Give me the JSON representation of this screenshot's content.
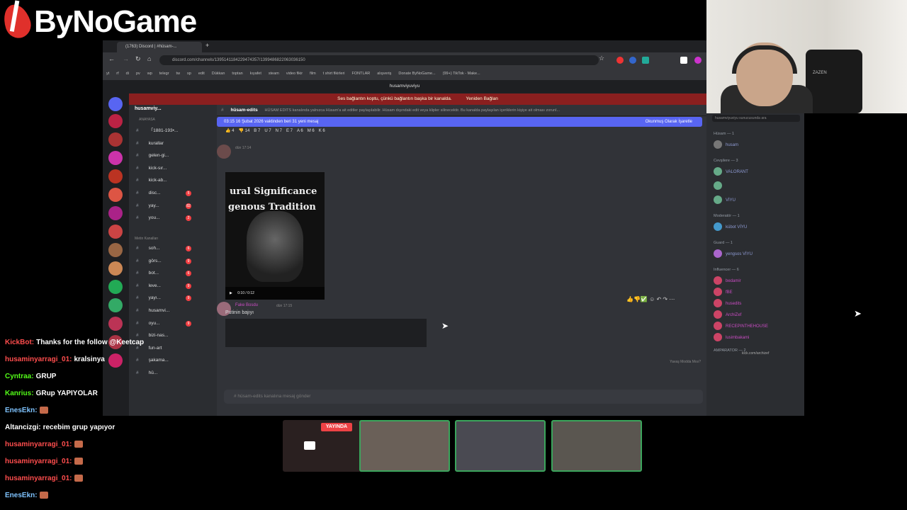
{
  "brand": {
    "logo_text": "ByNoGame"
  },
  "browser": {
    "tab_title": "(1763) Discord | #hüsam-...",
    "url": "discord.com/channels/1395141184229474357/1399486822063036150",
    "bookmarks": [
      "yt",
      "rf",
      "di",
      "pv",
      "wp",
      "telegr",
      "tw",
      "sp",
      "edit",
      "Dükkan",
      "toptan",
      "kıyafet",
      "steam",
      "video fikir",
      "film",
      "t shirt fikirleri",
      "FONTLAR",
      "alışveriş",
      "Donate ByNoGame...",
      "(99+) TikTok - Make..."
    ]
  },
  "discord": {
    "top_user": "husamviyuviyu",
    "banner": "Ses bağlantın koptu, çünkü bağlantın başka bir kanalda.",
    "banner_action": "Yeniden Bağlan",
    "server_name": "husamviy...",
    "category1": "ANAYASA",
    "category2": "Metin Kanalları",
    "channels_top": [
      {
        "name": "「1881-193•...",
        "badge": ""
      },
      {
        "name": "kurallar",
        "badge": ""
      },
      {
        "name": "gelen-gi...",
        "badge": ""
      },
      {
        "name": "kick-sır...",
        "badge": ""
      },
      {
        "name": "kick-ab...",
        "badge": ""
      },
      {
        "name": "disc...",
        "badge": "5"
      },
      {
        "name": "yay...",
        "badge": "82"
      },
      {
        "name": "you...",
        "badge": "2"
      }
    ],
    "channels_text": [
      {
        "name": "soh...",
        "badge": "6"
      },
      {
        "name": "görs...",
        "badge": "9"
      },
      {
        "name": "bot...",
        "badge": "6"
      },
      {
        "name": "leve...",
        "badge": "9"
      },
      {
        "name": "yayı...",
        "badge": "9"
      },
      {
        "name": "husamvi...",
        "badge": ""
      },
      {
        "name": "oyu...",
        "badge": "9"
      },
      {
        "name": "bizi-nas...",
        "badge": ""
      },
      {
        "name": "fun-art",
        "badge": ""
      },
      {
        "name": "şakama...",
        "badge": ""
      },
      {
        "name": "hü...",
        "badge": ""
      }
    ],
    "channel_name": "hüsam-edits",
    "channel_topic": "HÜSAM EDITS kanalında yalnızca Hüsam'a ait editler paylaşılabilir. Hüsam dışındaki edit veya klipler silinecektir. Bu kanalda paylaşılan içeriklerin kişiye ait olması zorunl...",
    "new_messages": "03:15 16 Şubat 2026 vaktinden beri 31 yeni mesaj",
    "mark_read": "Okunmuş Olarak İşaretle",
    "reactions1": [
      "👍 4",
      "👎 14",
      "B 7",
      "U 7",
      "N 7",
      "E 7",
      "A 6",
      "M 6",
      "K 6"
    ],
    "msg1_time": "dün 17:14",
    "video_text1": "ural Significance",
    "video_text2": "genous Tradition",
    "video_time": "0:10 / 0:12",
    "reactions2": [
      "👍 7",
      "👎 5",
      "3"
    ],
    "msg2_author": "Fake Bosdu",
    "msg2_time": "dün 17:15",
    "msg2_text": "Putinin bajıyı",
    "slow_mode": "Yavaş Modda Mısı?",
    "input_placeholder": "# hüsam-edits kanalına mesaj gönder",
    "search_placeholder": "husamviyuviyu sunucusunda ara"
  },
  "members": {
    "groups": [
      {
        "label": "Hüsam — 1",
        "members": [
          "husam"
        ]
      },
      {
        "label": "Cevşilere — 3",
        "members": [
          "VALORANT",
          "",
          "VİYU"
        ]
      },
      {
        "label": "Moderatör — 1",
        "members": [
          "kübot VİYU"
        ]
      },
      {
        "label": "Guard — 1",
        "members": [
          "yengsos VİYU"
        ]
      },
      {
        "label": "Influencer — 6",
        "members": [
          "bedamir",
          "fBE",
          "husedits",
          "ArchiZef",
          "RECEPINTHEHOUSE",
          "lusimbakami"
        ]
      },
      {
        "label": "AMPARATOR — 2",
        "members": []
      }
    ],
    "sub_text": "kick.com/archizef"
  },
  "webcam": {
    "chair_text": "ZAZEN"
  },
  "chat": [
    {
      "user": "KickBot:",
      "text": "Thanks for the follow @Keetcap",
      "color": "#ff4d4d"
    },
    {
      "user": "husaminyarragi_01:",
      "text": "kralsinya",
      "color": "#ff4d4d"
    },
    {
      "user": "Cyntraa:",
      "text": "GRUP",
      "color": "#53fc18"
    },
    {
      "user": "Kanrius:",
      "text": "GRup YAPIYOLAR",
      "color": "#53fc18"
    },
    {
      "user": "EnesEkn:",
      "text": "",
      "color": "#7fc3ff"
    },
    {
      "user": "Altancizgi:",
      "text": "recebim grup yapıyor",
      "color": "#ffffff"
    },
    {
      "user": "husaminyarragi_01:",
      "text": "",
      "color": "#ff4d4d"
    },
    {
      "user": "husaminyarragi_01:",
      "text": "",
      "color": "#ff4d4d"
    },
    {
      "user": "husaminyarragi_01:",
      "text": "",
      "color": "#ff4d4d"
    },
    {
      "user": "EnesEkn:",
      "text": "",
      "color": "#7fc3ff"
    }
  ],
  "thumbs": {
    "live_label": "YAYINDA"
  }
}
